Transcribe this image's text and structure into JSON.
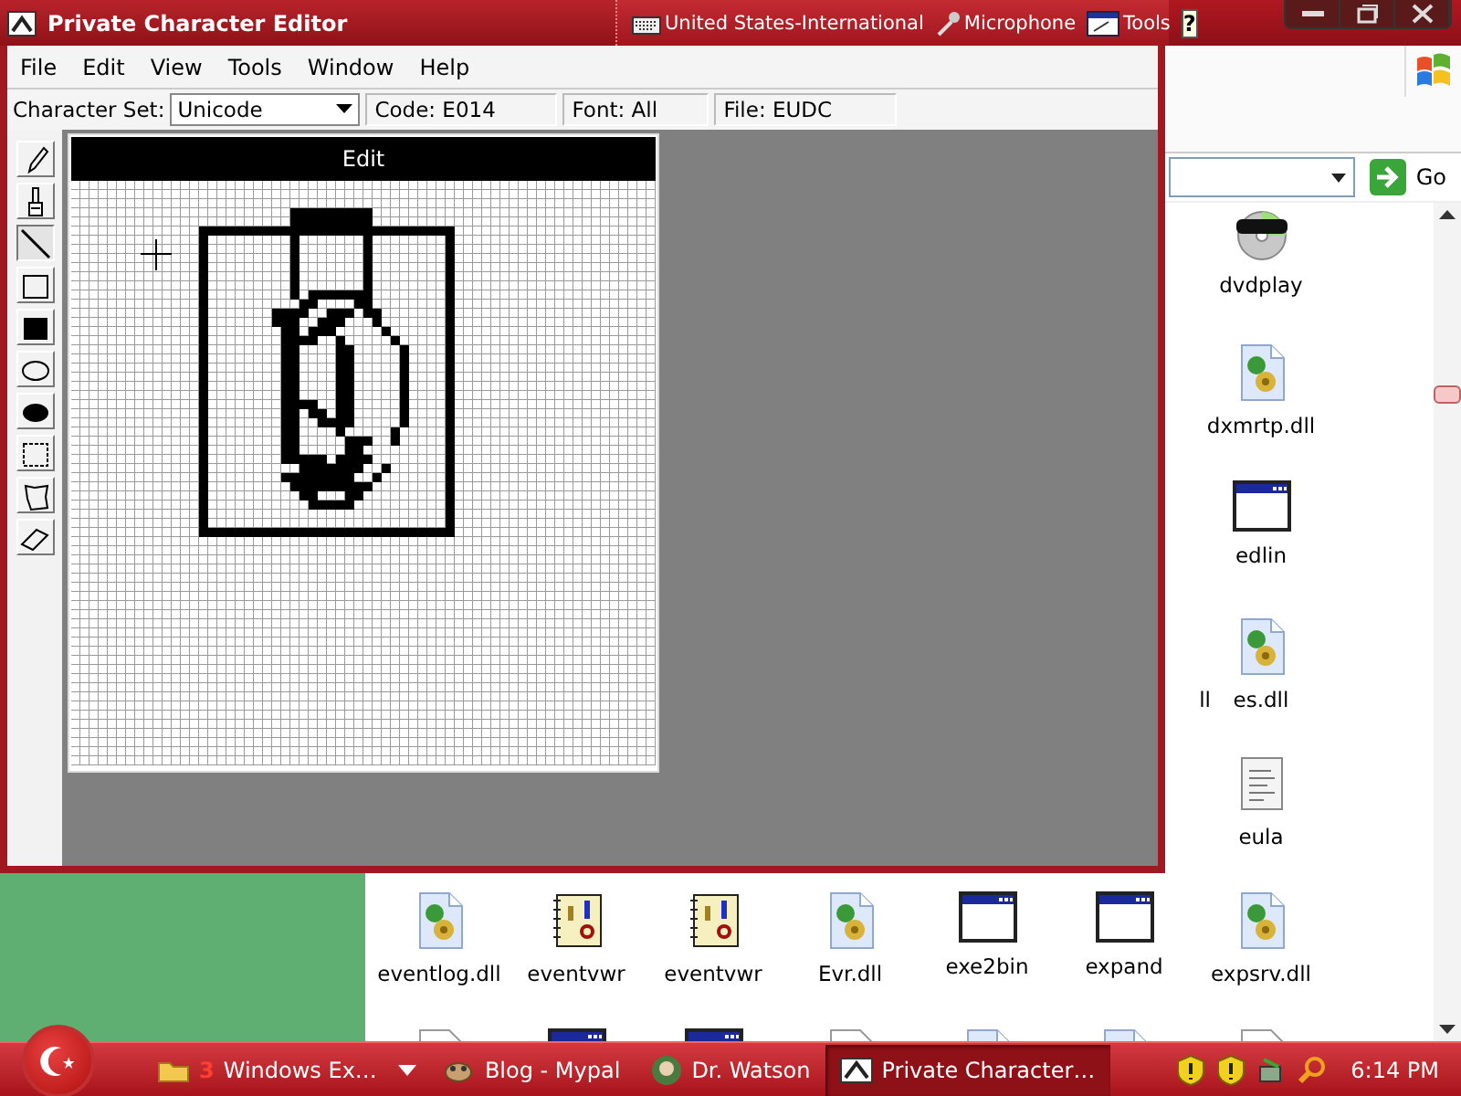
{
  "editor_window": {
    "title": "Private Character Editor",
    "menu": [
      "File",
      "Edit",
      "View",
      "Tools",
      "Window",
      "Help"
    ],
    "character_set_label": "Character Set:",
    "character_set": "Unicode",
    "code": "Code: E014",
    "font": "Font: All",
    "file": "File: EUDC",
    "tools": [
      {
        "kind": "pencil",
        "selected": false
      },
      {
        "kind": "brush",
        "selected": false
      },
      {
        "kind": "line",
        "selected": true
      },
      {
        "kind": "rectangle",
        "selected": false
      },
      {
        "kind": "filled-rectangle",
        "selected": false
      },
      {
        "kind": "ellipse",
        "selected": false
      },
      {
        "kind": "filled-ellipse",
        "selected": false
      },
      {
        "kind": "rect-select",
        "selected": false
      },
      {
        "kind": "freeform-select",
        "selected": false
      },
      {
        "kind": "eraser",
        "selected": false
      }
    ],
    "edit_pane": {
      "title": "Edit"
    }
  },
  "language_bar": {
    "items": [
      {
        "kind": "keyboard",
        "label": "United States-International"
      },
      {
        "kind": "microphone",
        "label": "Microphone"
      },
      {
        "kind": "tools",
        "label": "Tools"
      }
    ],
    "help": "?"
  },
  "explorer": {
    "go": "Go",
    "files": [
      {
        "name": "dvdplay",
        "kind": "dvd"
      },
      {
        "name": "dxmrtp.dll",
        "kind": "dll"
      },
      {
        "name": "edlin",
        "kind": "app"
      },
      {
        "name": "es.dll",
        "kind": "dll"
      },
      {
        "name": "eula",
        "kind": "text"
      },
      {
        "name": "eventlog.dll",
        "kind": "dll"
      },
      {
        "name": "eventvwr",
        "kind": "help"
      },
      {
        "name": "eventvwr",
        "kind": "help"
      },
      {
        "name": "Evr.dll",
        "kind": "dll"
      },
      {
        "name": "exe2bin",
        "kind": "app"
      },
      {
        "name": "expand",
        "kind": "app"
      },
      {
        "name": "expsrv.dll",
        "kind": "dll"
      }
    ],
    "partial_label": "ll",
    "partial_row": [
      {
        "kind": "app-file"
      },
      {
        "kind": "app"
      },
      {
        "kind": "app"
      },
      {
        "kind": "app-file"
      },
      {
        "kind": "dll"
      },
      {
        "kind": "dll"
      },
      {
        "kind": "doc"
      }
    ]
  },
  "taskbar": {
    "buttons": [
      {
        "kind": "folder",
        "count": "3",
        "label": "Windows Ex…",
        "selected": false
      },
      {
        "kind": "browser",
        "label": "Blog - Mypal",
        "selected": false
      },
      {
        "kind": "doctor",
        "label": "Dr. Watson",
        "selected": false
      },
      {
        "kind": "editor",
        "label": "Private Character…",
        "selected": true
      }
    ],
    "clock": "6:14 PM"
  }
}
